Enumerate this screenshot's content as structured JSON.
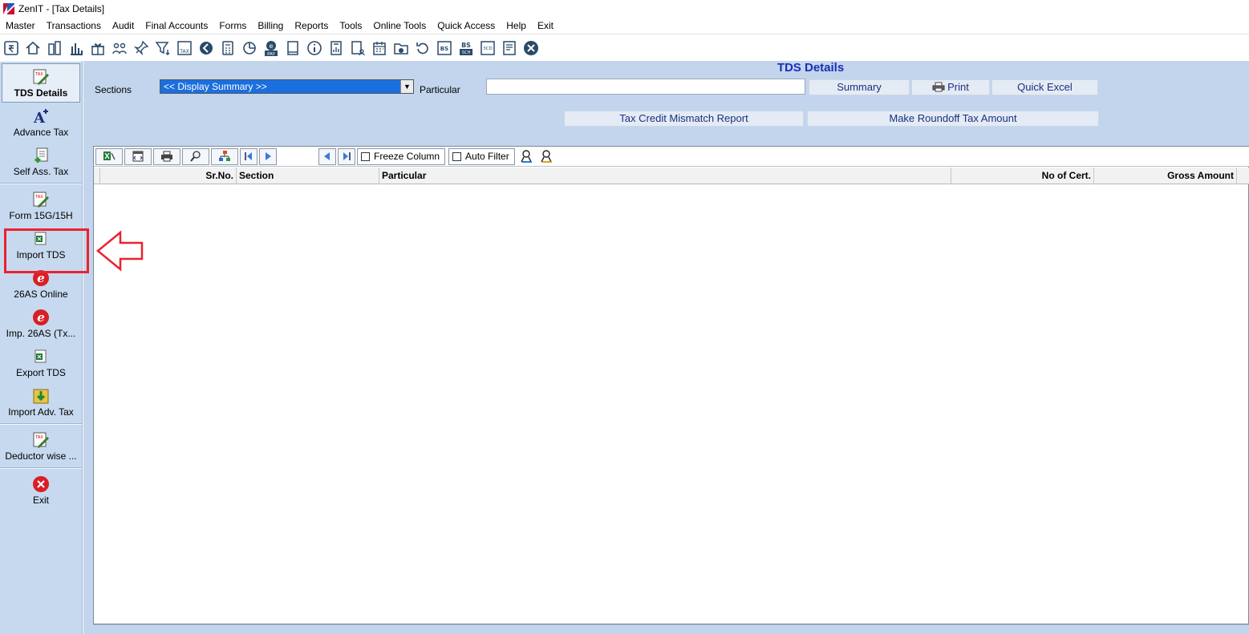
{
  "window": {
    "title": "ZenIT - [Tax Details]"
  },
  "menu": [
    "Master",
    "Transactions",
    "Audit",
    "Final Accounts",
    "Forms",
    "Billing",
    "Reports",
    "Tools",
    "Online Tools",
    "Quick Access",
    "Help",
    "Exit"
  ],
  "toolbar_icons": [
    "rupee-book",
    "home",
    "city",
    "bar-chart",
    "gift",
    "users",
    "pin",
    "filter",
    "tax",
    "rewind",
    "calculator",
    "pie",
    "epay",
    "book",
    "info",
    "report",
    "user-doc",
    "calendar",
    "folder-add",
    "refresh",
    "bs",
    "bs-sch",
    "3cd",
    "document",
    "close"
  ],
  "toolbar_labels": {
    "tax": "TAX",
    "epay": "PAY",
    "bs": "BS",
    "bs_sch": "BS",
    "bs_sch_sub": "SCH",
    "cd": "3CD"
  },
  "sidebar": {
    "items": [
      {
        "label": "TDS Details",
        "icon": "tax-pencil-icon",
        "active": true
      },
      {
        "label": "Advance Tax",
        "icon": "font-plus-icon"
      },
      {
        "label": "Self Ass. Tax",
        "icon": "doc-add-icon"
      },
      {
        "label": "Form 15G/15H",
        "icon": "tax-pencil-icon"
      },
      {
        "label": "Import TDS",
        "icon": "excel-icon"
      },
      {
        "label": "26AS Online",
        "icon": "e-icon"
      },
      {
        "label": "Imp. 26AS (Tx...",
        "icon": "e-icon"
      },
      {
        "label": "Export TDS",
        "icon": "excel-icon"
      },
      {
        "label": "Import Adv. Tax",
        "icon": "import-icon"
      },
      {
        "label": "Deductor wise ...",
        "icon": "tax-pencil-icon"
      },
      {
        "label": "Exit",
        "icon": "exit-icon"
      }
    ],
    "icon_text": {
      "tax": "TAX",
      "e": "e"
    }
  },
  "main": {
    "title": "TDS Details",
    "sections_label": "Sections",
    "sections_value": "<< Display Summary >>",
    "particular_label": "Particular",
    "particular_value": "",
    "buttons": {
      "summary": "Summary",
      "print": "Print",
      "quick_excel": "Quick Excel",
      "mismatch": "Tax Credit Mismatch Report",
      "roundoff": "Make Roundoff Tax Amount"
    },
    "grid": {
      "freeze_label": "Freeze Column",
      "autofilter_label": "Auto Filter",
      "columns": [
        "",
        "Sr.No.",
        "Section",
        "Particular",
        "No of Cert.",
        "Gross Amount"
      ]
    }
  },
  "colors": {
    "accent": "#1a2fb8",
    "sidebar_bg": "#c7d9ee",
    "panel_bg": "#c2d5ec",
    "highlight": "#e8232f"
  }
}
